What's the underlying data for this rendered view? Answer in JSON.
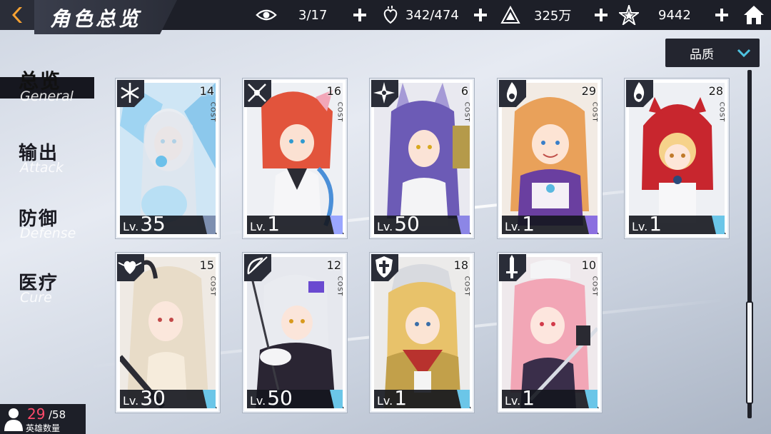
{
  "header": {
    "title": "角色总览",
    "resources": [
      {
        "icon": "eye-icon",
        "value": "3/17"
      },
      {
        "icon": "heart-anatomy-icon",
        "value": "342/474"
      },
      {
        "icon": "pyramid-icon",
        "value": "325万"
      },
      {
        "icon": "star-shard-icon",
        "value": "9442"
      }
    ]
  },
  "sidebar": {
    "items": [
      {
        "cn": "总览",
        "en": "General",
        "active": true
      },
      {
        "cn": "输出",
        "en": "Attack",
        "active": false
      },
      {
        "cn": "防御",
        "en": "Defense",
        "active": false
      },
      {
        "cn": "医疗",
        "en": "Cure",
        "active": false
      }
    ]
  },
  "filter": {
    "label": "品质"
  },
  "cards": [
    {
      "cost": "14",
      "cost_label": "COST",
      "lv_prefix": "Lv.",
      "level": "35",
      "class_icon": "snowflake-class-icon",
      "accent": "#7d8fb0"
    },
    {
      "cost": "16",
      "cost_label": "COST",
      "lv_prefix": "Lv.",
      "level": "1",
      "class_icon": "crossed-swords-class-icon",
      "accent": "#9aa6ff"
    },
    {
      "cost": "6",
      "cost_label": "COST",
      "lv_prefix": "Lv.",
      "level": "50",
      "class_icon": "shuriken-class-icon",
      "accent": "#8c86e6"
    },
    {
      "cost": "29",
      "cost_label": "COST",
      "lv_prefix": "Lv.",
      "level": "1",
      "class_icon": "flame-class-icon",
      "accent": "#8b6fe0"
    },
    {
      "cost": "28",
      "cost_label": "COST",
      "lv_prefix": "Lv.",
      "level": "1",
      "class_icon": "flame-class-icon",
      "accent": "#6bc6e8"
    },
    {
      "cost": "15",
      "cost_label": "COST",
      "lv_prefix": "Lv.",
      "level": "30",
      "class_icon": "heart-wings-class-icon",
      "accent": "#6bc6e8"
    },
    {
      "cost": "12",
      "cost_label": "COST",
      "lv_prefix": "Lv.",
      "level": "50",
      "class_icon": "bow-class-icon",
      "accent": "#6bc6e8"
    },
    {
      "cost": "18",
      "cost_label": "COST",
      "lv_prefix": "Lv.",
      "level": "1",
      "class_icon": "shield-cross-class-icon",
      "accent": "#6bc6e8"
    },
    {
      "cost": "10",
      "cost_label": "COST",
      "lv_prefix": "Lv.",
      "level": "1",
      "class_icon": "sword-class-icon",
      "accent": "#6bc6e8"
    }
  ],
  "hero_count": {
    "current": "29",
    "max": "/58",
    "label": "英雄数量"
  }
}
